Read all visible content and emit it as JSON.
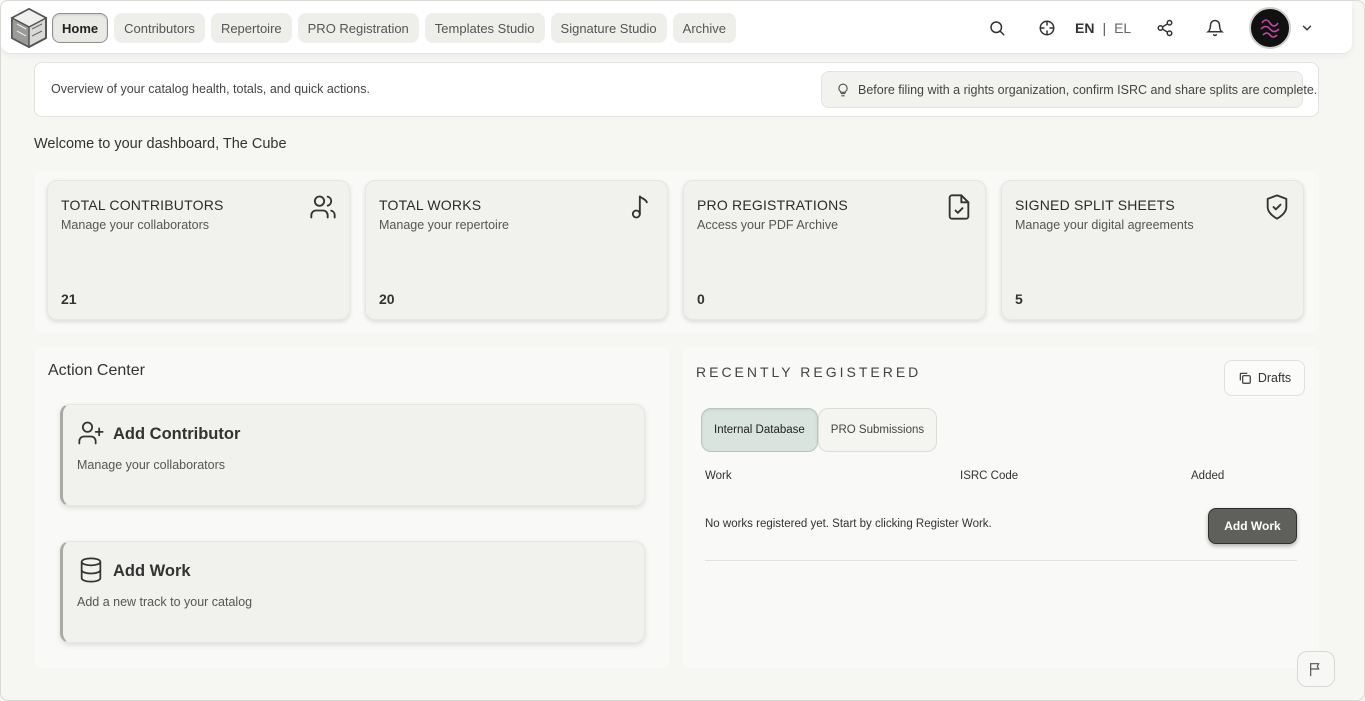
{
  "nav": {
    "logo_icon": "cube-logo-icon",
    "tabs": [
      {
        "label": "Home",
        "active": true
      },
      {
        "label": "Contributors"
      },
      {
        "label": "Repertoire"
      },
      {
        "label": "PRO Registration"
      },
      {
        "label": "Templates Studio"
      },
      {
        "label": "Signature Studio"
      },
      {
        "label": "Archive"
      }
    ],
    "lang_active": "EN",
    "lang_sep": "|",
    "lang_other": "EL",
    "icons": [
      "search-icon",
      "crosshair-icon",
      "share-icon",
      "bell-icon",
      "chevron-down-icon"
    ]
  },
  "info": {
    "text": "Overview of your catalog health, totals, and quick actions.",
    "tip": "Before filing with a rights organization, confirm ISRC and share splits are complete."
  },
  "welcome": "Welcome to your dashboard, The Cube",
  "stats": [
    {
      "title": "TOTAL CONTRIBUTORS",
      "sub": "Manage your collaborators",
      "value": "21",
      "icon": "users-icon"
    },
    {
      "title": "TOTAL WORKS",
      "sub": "Manage your repertoire",
      "value": "20",
      "icon": "music-note-icon"
    },
    {
      "title": "PRO REGISTRATIONS",
      "sub": "Access your PDF Archive",
      "value": "0",
      "icon": "file-check-icon"
    },
    {
      "title": "SIGNED SPLIT SHEETS",
      "sub": "Manage your digital agreements",
      "value": "5",
      "icon": "shield-check-icon"
    }
  ],
  "action_center": {
    "title": "Action Center",
    "cards": [
      {
        "title": "Add Contributor",
        "sub": "Manage your collaborators",
        "icon": "user-plus-icon"
      },
      {
        "title": "Add Work",
        "sub": "Add a new track to your catalog",
        "icon": "database-icon"
      }
    ]
  },
  "recent": {
    "title": "RECENTLY REGISTERED",
    "drafts_label": "Drafts",
    "tabs": [
      {
        "label": "Internal Database",
        "active": true
      },
      {
        "label": "PRO Submissions"
      }
    ],
    "columns": [
      "Work",
      "ISRC Code",
      "Added"
    ],
    "empty_text": "No works registered yet. Start by clicking Register Work.",
    "add_work_label": "Add Work"
  },
  "colors": {
    "background": "#f6f6f3",
    "card": "#f1f1ee",
    "active_tab": "#d9e4de",
    "primary_button": "#5f5f5c"
  }
}
